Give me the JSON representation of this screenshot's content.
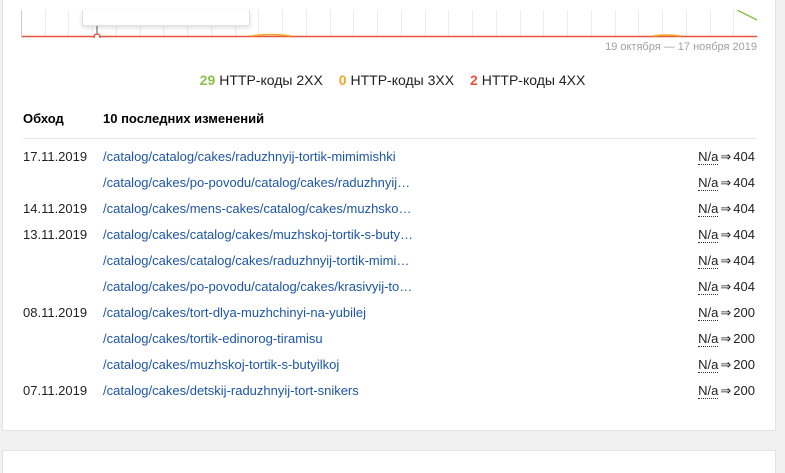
{
  "chart": {
    "date_range": "19 октября — 17 ноября 2019",
    "colors": {
      "2xx": "#8bc34a",
      "3xx": "#f5a623",
      "4xx": "#e8553d"
    }
  },
  "legend": [
    {
      "count": "29",
      "label": "HTTP-коды 2XX",
      "color": "#8bc34a"
    },
    {
      "count": "0",
      "label": "HTTP-коды 3XX",
      "color": "#f5a623"
    },
    {
      "count": "2",
      "label": "HTTP-коды 4XX",
      "color": "#e8553d"
    }
  ],
  "table": {
    "col_date": "Обход",
    "col_changes": "10 последних изменений",
    "arrow": "⇒",
    "rows": [
      {
        "date": "17.11.2019",
        "url": "/catalog/catalog/cakes/raduzhnyij-tortik-mimimishki",
        "from": "N/a",
        "to": "404"
      },
      {
        "date": "",
        "url": "/catalog/cakes/po-povodu/catalog/cakes/raduzhnyij…",
        "from": "N/a",
        "to": "404"
      },
      {
        "date": "14.11.2019",
        "url": "/catalog/cakes/mens-cakes/catalog/cakes/muzhsko…",
        "from": "N/a",
        "to": "404"
      },
      {
        "date": "13.11.2019",
        "url": "/catalog/cakes/catalog/cakes/muzhskoj-tortik-s-buty…",
        "from": "N/a",
        "to": "404"
      },
      {
        "date": "",
        "url": "/catalog/cakes/catalog/cakes/raduzhnyij-tortik-mimi…",
        "from": "N/a",
        "to": "404"
      },
      {
        "date": "",
        "url": "/catalog/cakes/po-povodu/catalog/cakes/krasivyij-to…",
        "from": "N/a",
        "to": "404"
      },
      {
        "date": "08.11.2019",
        "url": "/catalog/cakes/tort-dlya-muzhchinyi-na-yubilej",
        "from": "N/a",
        "to": "200"
      },
      {
        "date": "",
        "url": "/catalog/cakes/tortik-edinorog-tiramisu",
        "from": "N/a",
        "to": "200"
      },
      {
        "date": "",
        "url": "/catalog/cakes/muzhskoj-tortik-s-butyilkoj",
        "from": "N/a",
        "to": "200"
      },
      {
        "date": "07.11.2019",
        "url": "/catalog/cakes/detskij-raduzhnyij-tort-snikers",
        "from": "N/a",
        "to": "200"
      }
    ]
  }
}
